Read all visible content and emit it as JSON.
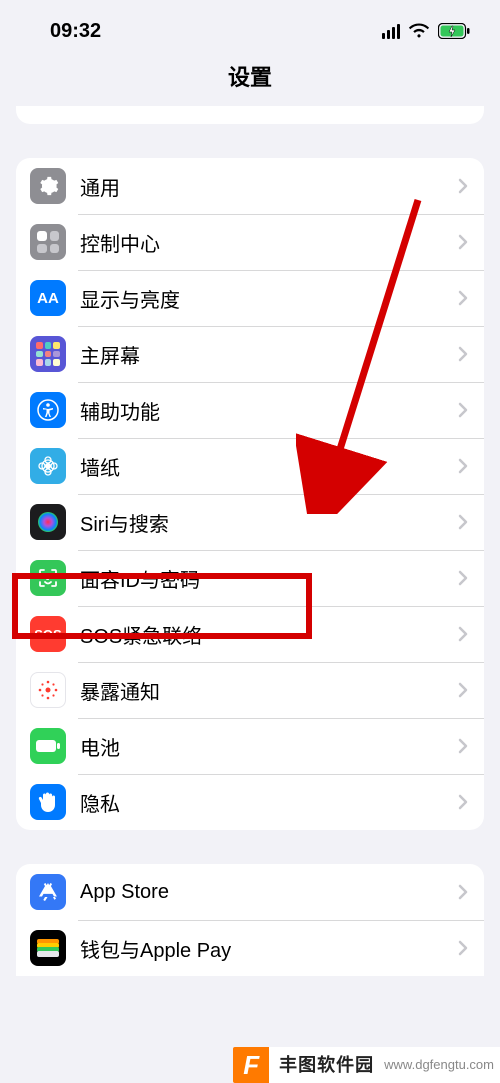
{
  "status": {
    "time": "09:32"
  },
  "nav": {
    "title": "设置"
  },
  "group1": [
    {
      "key": "general",
      "label": "通用"
    },
    {
      "key": "control-center",
      "label": "控制中心"
    },
    {
      "key": "display",
      "label": "显示与亮度",
      "txt": "AA"
    },
    {
      "key": "home-screen",
      "label": "主屏幕"
    },
    {
      "key": "accessibility",
      "label": "辅助功能"
    },
    {
      "key": "wallpaper",
      "label": "墙纸"
    },
    {
      "key": "siri",
      "label": "Siri与搜索"
    },
    {
      "key": "faceid",
      "label": "面容ID与密码"
    },
    {
      "key": "sos",
      "label": "SOS紧急联络",
      "txt": "SOS"
    },
    {
      "key": "exposure",
      "label": "暴露通知"
    },
    {
      "key": "battery",
      "label": "电池"
    },
    {
      "key": "privacy",
      "label": "隐私"
    }
  ],
  "group2": [
    {
      "key": "app-store",
      "label": "App Store"
    },
    {
      "key": "wallet",
      "label": "钱包与Apple Pay"
    }
  ],
  "watermark": {
    "logo": "F",
    "title": "丰图软件园",
    "domain": "www.dgfengtu.com"
  }
}
